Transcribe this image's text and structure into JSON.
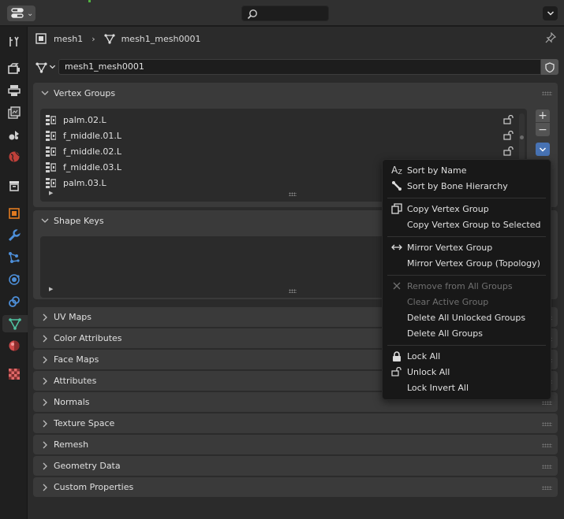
{
  "breadcrumb": {
    "object": "mesh1",
    "mesh": "mesh1_mesh0001"
  },
  "mesh_name": "mesh1_mesh0001",
  "vertex_groups": {
    "title": "Vertex Groups",
    "items": [
      "palm.02.L",
      "f_middle.01.L",
      "f_middle.02.L",
      "f_middle.03.L",
      "palm.03.L"
    ]
  },
  "shape_keys": {
    "title": "Shape Keys"
  },
  "panels": [
    "UV Maps",
    "Color Attributes",
    "Face Maps",
    "Attributes",
    "Normals",
    "Texture Space",
    "Remesh",
    "Geometry Data",
    "Custom Properties"
  ],
  "menu": {
    "sort_name": "Sort by Name",
    "sort_bone": "Sort by Bone Hierarchy",
    "copy_group": "Copy Vertex Group",
    "copy_selected": "Copy Vertex Group to Selected",
    "mirror": "Mirror Vertex Group",
    "mirror_topo": "Mirror Vertex Group (Topology)",
    "remove_all": "Remove from All Groups",
    "clear_active": "Clear Active Group",
    "delete_unlocked": "Delete All Unlocked Groups",
    "delete_all": "Delete All Groups",
    "lock_all": "Lock All",
    "unlock_all": "Unlock All",
    "lock_invert": "Lock Invert All"
  },
  "colors": {
    "accent": "#4772b3",
    "mesh_tab": "#4fc3a1"
  }
}
